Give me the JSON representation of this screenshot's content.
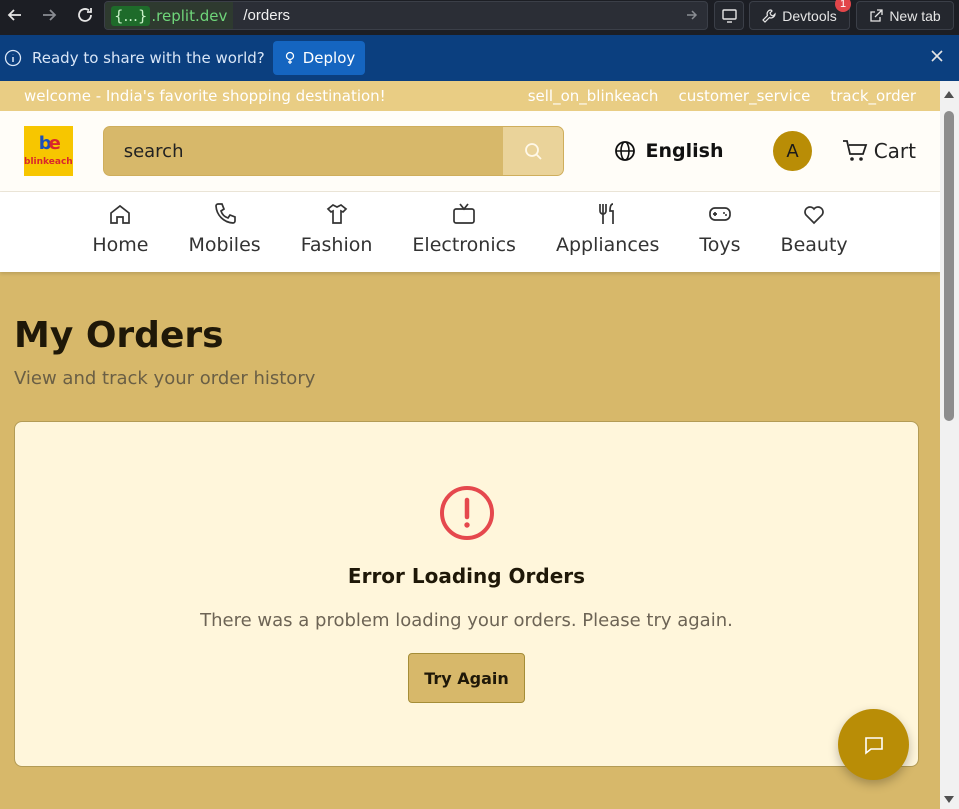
{
  "browser": {
    "host_tag": "{...}",
    "host_rest": ".replit.dev",
    "path": "/orders",
    "devtools_label": "Devtools",
    "devtools_badge": "1",
    "newtab_label": "New tab"
  },
  "deploy_banner": {
    "message": "Ready to share with the world?",
    "button_label": "Deploy"
  },
  "topstrip": {
    "welcome": "welcome - India's favorite shopping destination!",
    "links": [
      "sell_on_blinkeach",
      "customer_service",
      "track_order"
    ]
  },
  "header": {
    "logo_text": "blinkeach",
    "search_placeholder": "search",
    "language": "English",
    "avatar_initial": "A",
    "cart_label": "Cart"
  },
  "categories": [
    {
      "label": "Home",
      "icon": "home-icon"
    },
    {
      "label": "Mobiles",
      "icon": "phone-icon"
    },
    {
      "label": "Fashion",
      "icon": "shirt-icon"
    },
    {
      "label": "Electronics",
      "icon": "tv-icon"
    },
    {
      "label": "Appliances",
      "icon": "utensils-icon"
    },
    {
      "label": "Toys",
      "icon": "gamepad-icon"
    },
    {
      "label": "Beauty",
      "icon": "heart-icon"
    }
  ],
  "page": {
    "title": "My Orders",
    "subtitle": "View and track your order history"
  },
  "error": {
    "title": "Error Loading Orders",
    "message": "There was a problem loading your orders. Please try again.",
    "retry_label": "Try Again"
  },
  "colors": {
    "page_bg": "#d7b86a",
    "accent": "#b98d06",
    "error_red": "#e5484d",
    "deploy_blue": "#0b3f7f"
  }
}
